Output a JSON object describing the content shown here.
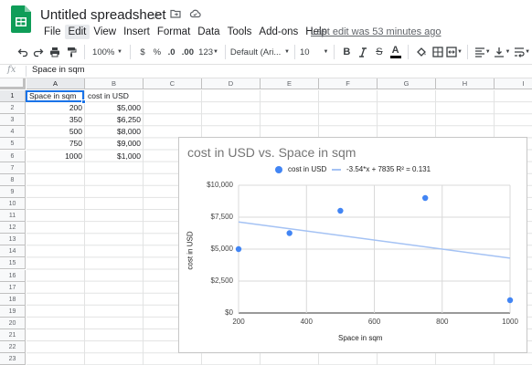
{
  "app": {
    "doc_title": "Untitled spreadsheet",
    "last_edit": "Last edit was 53 minutes ago",
    "menu": [
      "File",
      "Edit",
      "View",
      "Insert",
      "Format",
      "Data",
      "Tools",
      "Add-ons",
      "Help"
    ],
    "active_menu": "Edit"
  },
  "toolbar": {
    "zoom": "100%",
    "currency": "$",
    "percent": "%",
    "dec_decrease": ".0",
    "dec_increase": ".00",
    "more_formats": "123",
    "font": "Default (Ari...",
    "font_size": "10",
    "bold": "B",
    "text_color_letter": "A",
    "strike_letter": "S"
  },
  "formula_bar": {
    "fx": "fx",
    "value": "Space in sqm"
  },
  "grid": {
    "columns": [
      "A",
      "B",
      "C",
      "D",
      "E",
      "F",
      "G",
      "H",
      "I"
    ],
    "selected_column": "A",
    "rows": [
      "1",
      "2",
      "3",
      "4",
      "5",
      "6",
      "7",
      "8",
      "9",
      "10",
      "11",
      "12",
      "13",
      "14",
      "15",
      "16",
      "17",
      "18",
      "19",
      "20",
      "21",
      "22",
      "23"
    ],
    "selected_row": "1",
    "headers": [
      "Space in sqm",
      "cost in USD"
    ],
    "data": [
      [
        "200",
        "$5,000"
      ],
      [
        "350",
        "$6,250"
      ],
      [
        "500",
        "$8,000"
      ],
      [
        "750",
        "$9,000"
      ],
      [
        "1000",
        "$1,000"
      ]
    ]
  },
  "chart": {
    "title": "cost in USD vs. Space in sqm",
    "legend_series": "cost in USD",
    "legend_trend": "-3.54*x + 7835 R² = 0.131",
    "y_tick_labels": [
      "$10,000",
      "$7,500",
      "$5,000",
      "$2,500",
      "$0"
    ],
    "x_tick_labels": [
      "200",
      "400",
      "600",
      "800",
      "1000"
    ],
    "xlabel": "Space in sqm",
    "ylabel": "cost in USD"
  },
  "chart_data": {
    "type": "scatter",
    "title": "cost in USD vs. Space in sqm",
    "xlabel": "Space in sqm",
    "ylabel": "cost in USD",
    "xlim": [
      200,
      1000
    ],
    "ylim": [
      0,
      10000
    ],
    "grid": true,
    "legend": "top",
    "series": [
      {
        "name": "cost in USD",
        "color": "#4285f4",
        "x": [
          200,
          350,
          500,
          750,
          1000
        ],
        "y": [
          5000,
          6250,
          8000,
          9000,
          1000
        ]
      }
    ],
    "trendline": {
      "label": "-3.54*x + 7835 R² = 0.131",
      "slope": -3.54,
      "intercept": 7835,
      "color": "#a4c2f4"
    }
  }
}
